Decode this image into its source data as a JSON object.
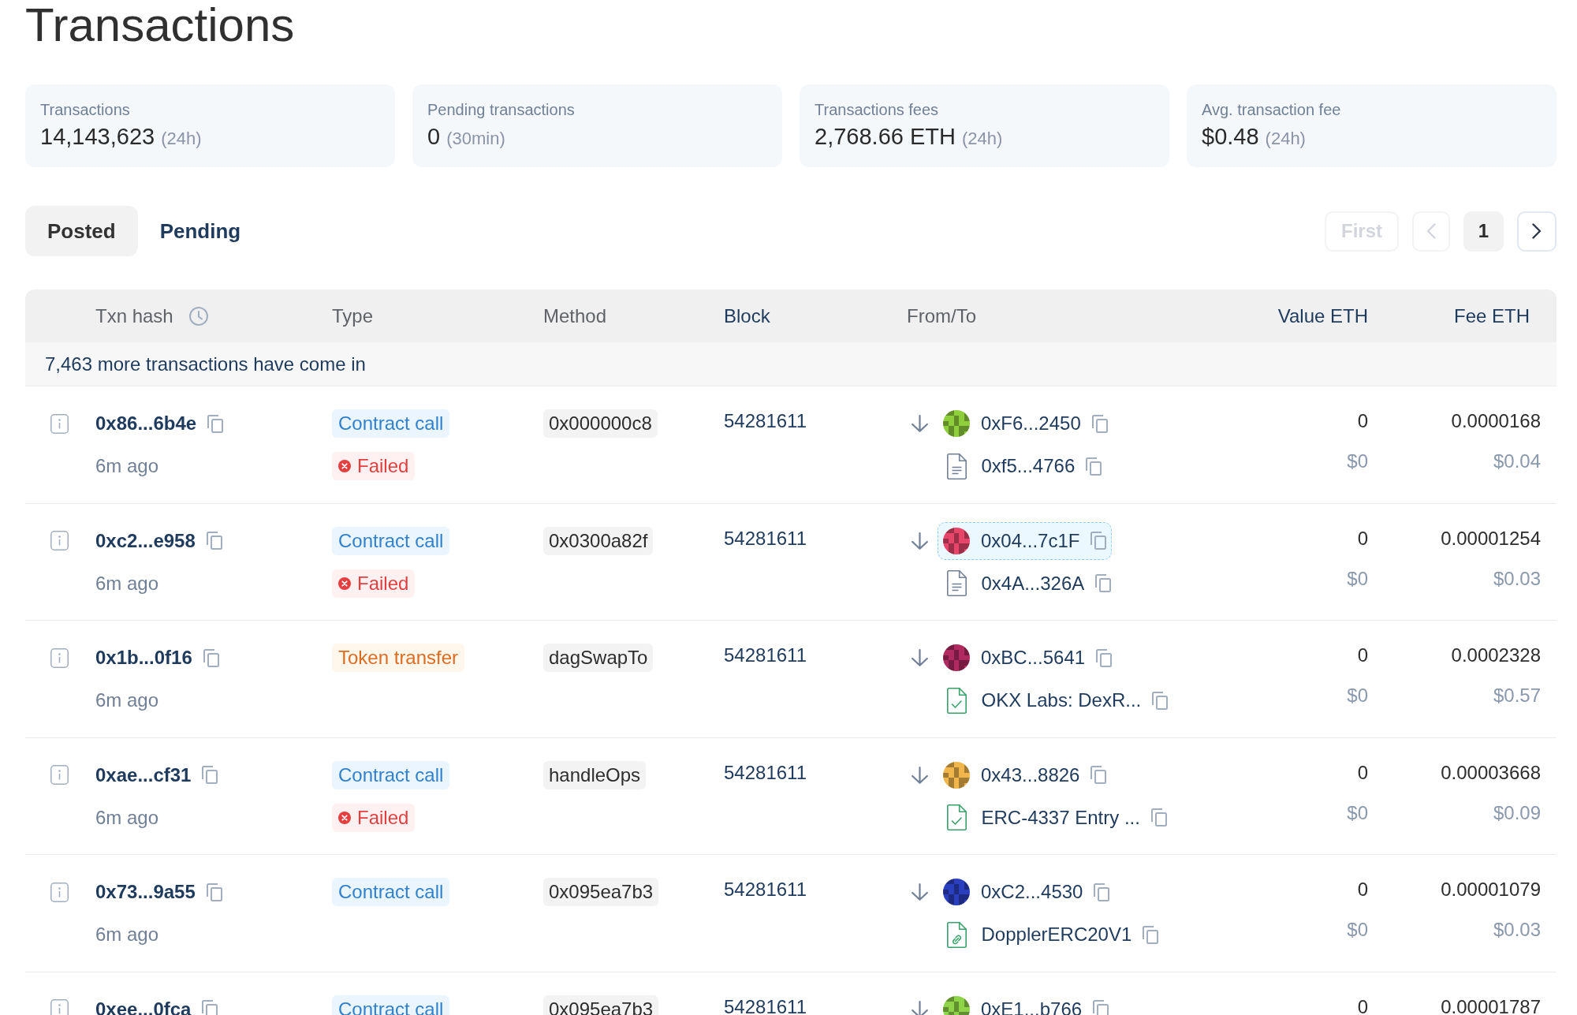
{
  "page_title": "Transactions",
  "stats": [
    {
      "label": "Transactions",
      "value": "14,143,623",
      "period": "(24h)"
    },
    {
      "label": "Pending transactions",
      "value": "0",
      "period": "(30min)"
    },
    {
      "label": "Transactions fees",
      "value": "2,768.66 ETH",
      "period": "(24h)"
    },
    {
      "label": "Avg. transaction fee",
      "value": "$0.48",
      "period": "(24h)"
    }
  ],
  "tabs": [
    {
      "label": "Posted",
      "selected": true
    },
    {
      "label": "Pending",
      "selected": false
    }
  ],
  "pagination": {
    "first": {
      "label": "First",
      "disabled": true
    },
    "previous": {
      "disabled": true
    },
    "current_page": "1",
    "next": {
      "disabled": false
    }
  },
  "table": {
    "columns": [
      {
        "label": "Txn hash",
        "kind": "toggle"
      },
      {
        "label": "Type",
        "kind": "plain"
      },
      {
        "label": "Method",
        "kind": "plain"
      },
      {
        "label": "Block",
        "kind": "link"
      },
      {
        "label": "From/To",
        "kind": "plain"
      },
      {
        "label": "Value ETH",
        "kind": "link"
      },
      {
        "label": "Fee ETH",
        "kind": "link"
      }
    ],
    "notice": "7,463 more transactions have come in",
    "rows": [
      {
        "hash": "0x86...6b4e",
        "age": "6m ago",
        "type": {
          "label": "Contract call",
          "kind": "call"
        },
        "status": "Failed",
        "method": "0x000000c8",
        "block": "54281611",
        "from": {
          "address": "0xF6...2450",
          "color": "#8fcf3c",
          "highlighted": false
        },
        "to": {
          "address": "0xf5...4766",
          "kind": "contract"
        },
        "value": "0",
        "value_usd": "$0",
        "fee": "0.0000168",
        "fee_usd": "$0.04"
      },
      {
        "hash": "0xc2...e958",
        "age": "6m ago",
        "type": {
          "label": "Contract call",
          "kind": "call"
        },
        "status": "Failed",
        "method": "0x0300a82f",
        "block": "54281611",
        "from": {
          "address": "0x04...7c1F",
          "color": "#e8456b",
          "highlighted": true
        },
        "to": {
          "address": "0x4A...326A",
          "kind": "contract"
        },
        "value": "0",
        "value_usd": "$0",
        "fee": "0.00001254",
        "fee_usd": "$0.03"
      },
      {
        "hash": "0x1b...0f16",
        "age": "6m ago",
        "type": {
          "label": "Token transfer",
          "kind": "transfer"
        },
        "method": "dagSwapTo",
        "block": "54281611",
        "from": {
          "address": "0xBC...5641",
          "color": "#b02a5f",
          "highlighted": false
        },
        "to": {
          "address": "OKX Labs: DexR...",
          "kind": "verified"
        },
        "value": "0",
        "value_usd": "$0",
        "fee": "0.0002328",
        "fee_usd": "$0.57"
      },
      {
        "hash": "0xae...cf31",
        "age": "6m ago",
        "type": {
          "label": "Contract call",
          "kind": "call"
        },
        "status": "Failed",
        "method": "handleOps",
        "block": "54281611",
        "from": {
          "address": "0x43...8826",
          "color": "#f0b64c",
          "highlighted": false
        },
        "to": {
          "address": "ERC-4337 Entry ...",
          "kind": "verified"
        },
        "value": "0",
        "value_usd": "$0",
        "fee": "0.00003668",
        "fee_usd": "$0.09"
      },
      {
        "hash": "0x73...9a55",
        "age": "6m ago",
        "type": {
          "label": "Contract call",
          "kind": "call"
        },
        "method": "0x095ea7b3",
        "block": "54281611",
        "from": {
          "address": "0xC2...4530",
          "color": "#2a3fbf",
          "highlighted": false
        },
        "to": {
          "address": "DopplerERC20V1",
          "kind": "linked"
        },
        "value": "0",
        "value_usd": "$0",
        "fee": "0.00001079",
        "fee_usd": "$0.03"
      },
      {
        "hash": "0xee...0fca",
        "type": {
          "label": "Contract call",
          "kind": "call"
        },
        "method": "0x095ea7b3",
        "block": "54281611",
        "from": {
          "address": "0xE1...b766",
          "color": "#8fd448",
          "highlighted": false
        },
        "value": "0",
        "fee": "0.00001787"
      }
    ]
  }
}
